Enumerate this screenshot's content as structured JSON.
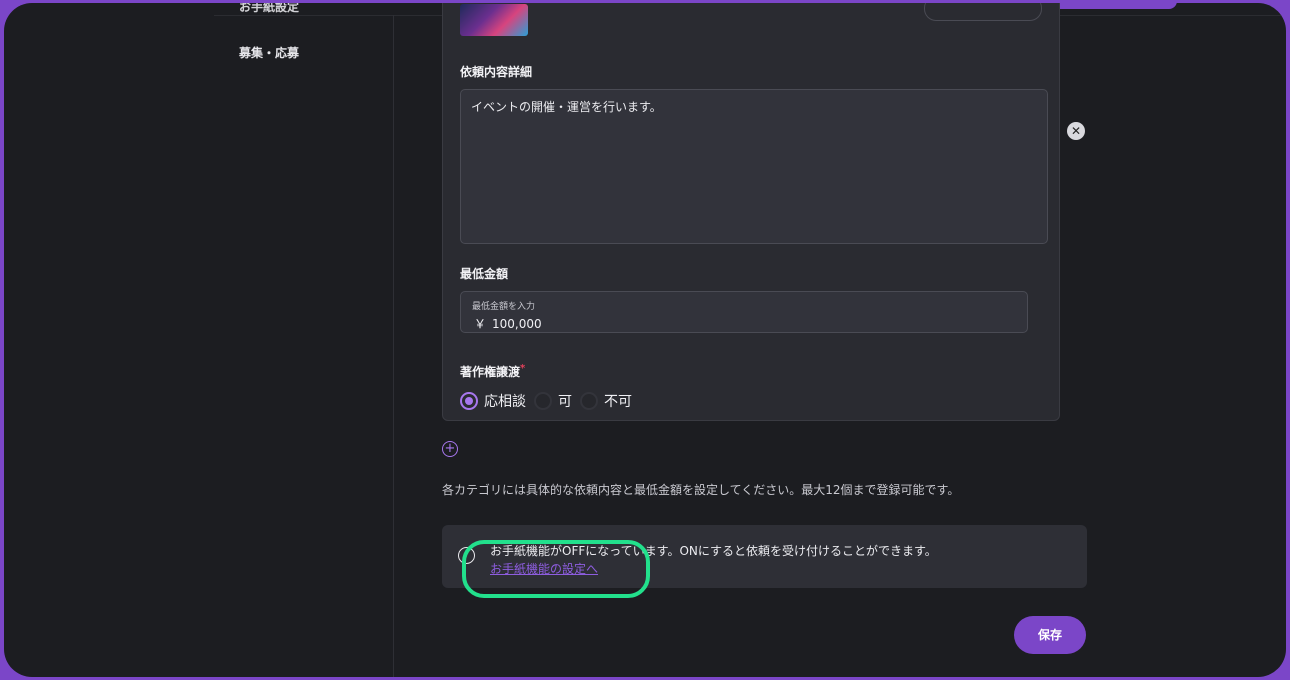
{
  "sidebar": {
    "partial_item": "お手紙設定",
    "recruit_label": "募集・応募"
  },
  "request_card": {
    "detail_label": "依頼内容詳細",
    "detail_value": "イベントの開催・運営を行います。",
    "min_amount_label": "最低金額",
    "min_amount_placeholder": "最低金額を入力",
    "currency": "￥",
    "min_amount_value": "100,000",
    "copyright_label": "著作権譲渡",
    "required_mark": "*",
    "copyright_options": [
      "応相談",
      "可",
      "不可"
    ],
    "copyright_selected": "応相談"
  },
  "help_text": "各カテゴリには具体的な依頼内容と最低金額を設定してください。最大12個まで登録可能です。",
  "notice": {
    "text": "お手紙機能がOFFになっています。ONにすると依頼を受け付けることができます。",
    "link": "お手紙機能の設定へ"
  },
  "save_label": "保存",
  "icons": {
    "close": "close-icon",
    "add": "plus-circle-icon",
    "info": "info-circle-icon"
  },
  "colors": {
    "accent": "#7b46c8",
    "highlight": "#22e08c",
    "link": "#8e5de0"
  }
}
